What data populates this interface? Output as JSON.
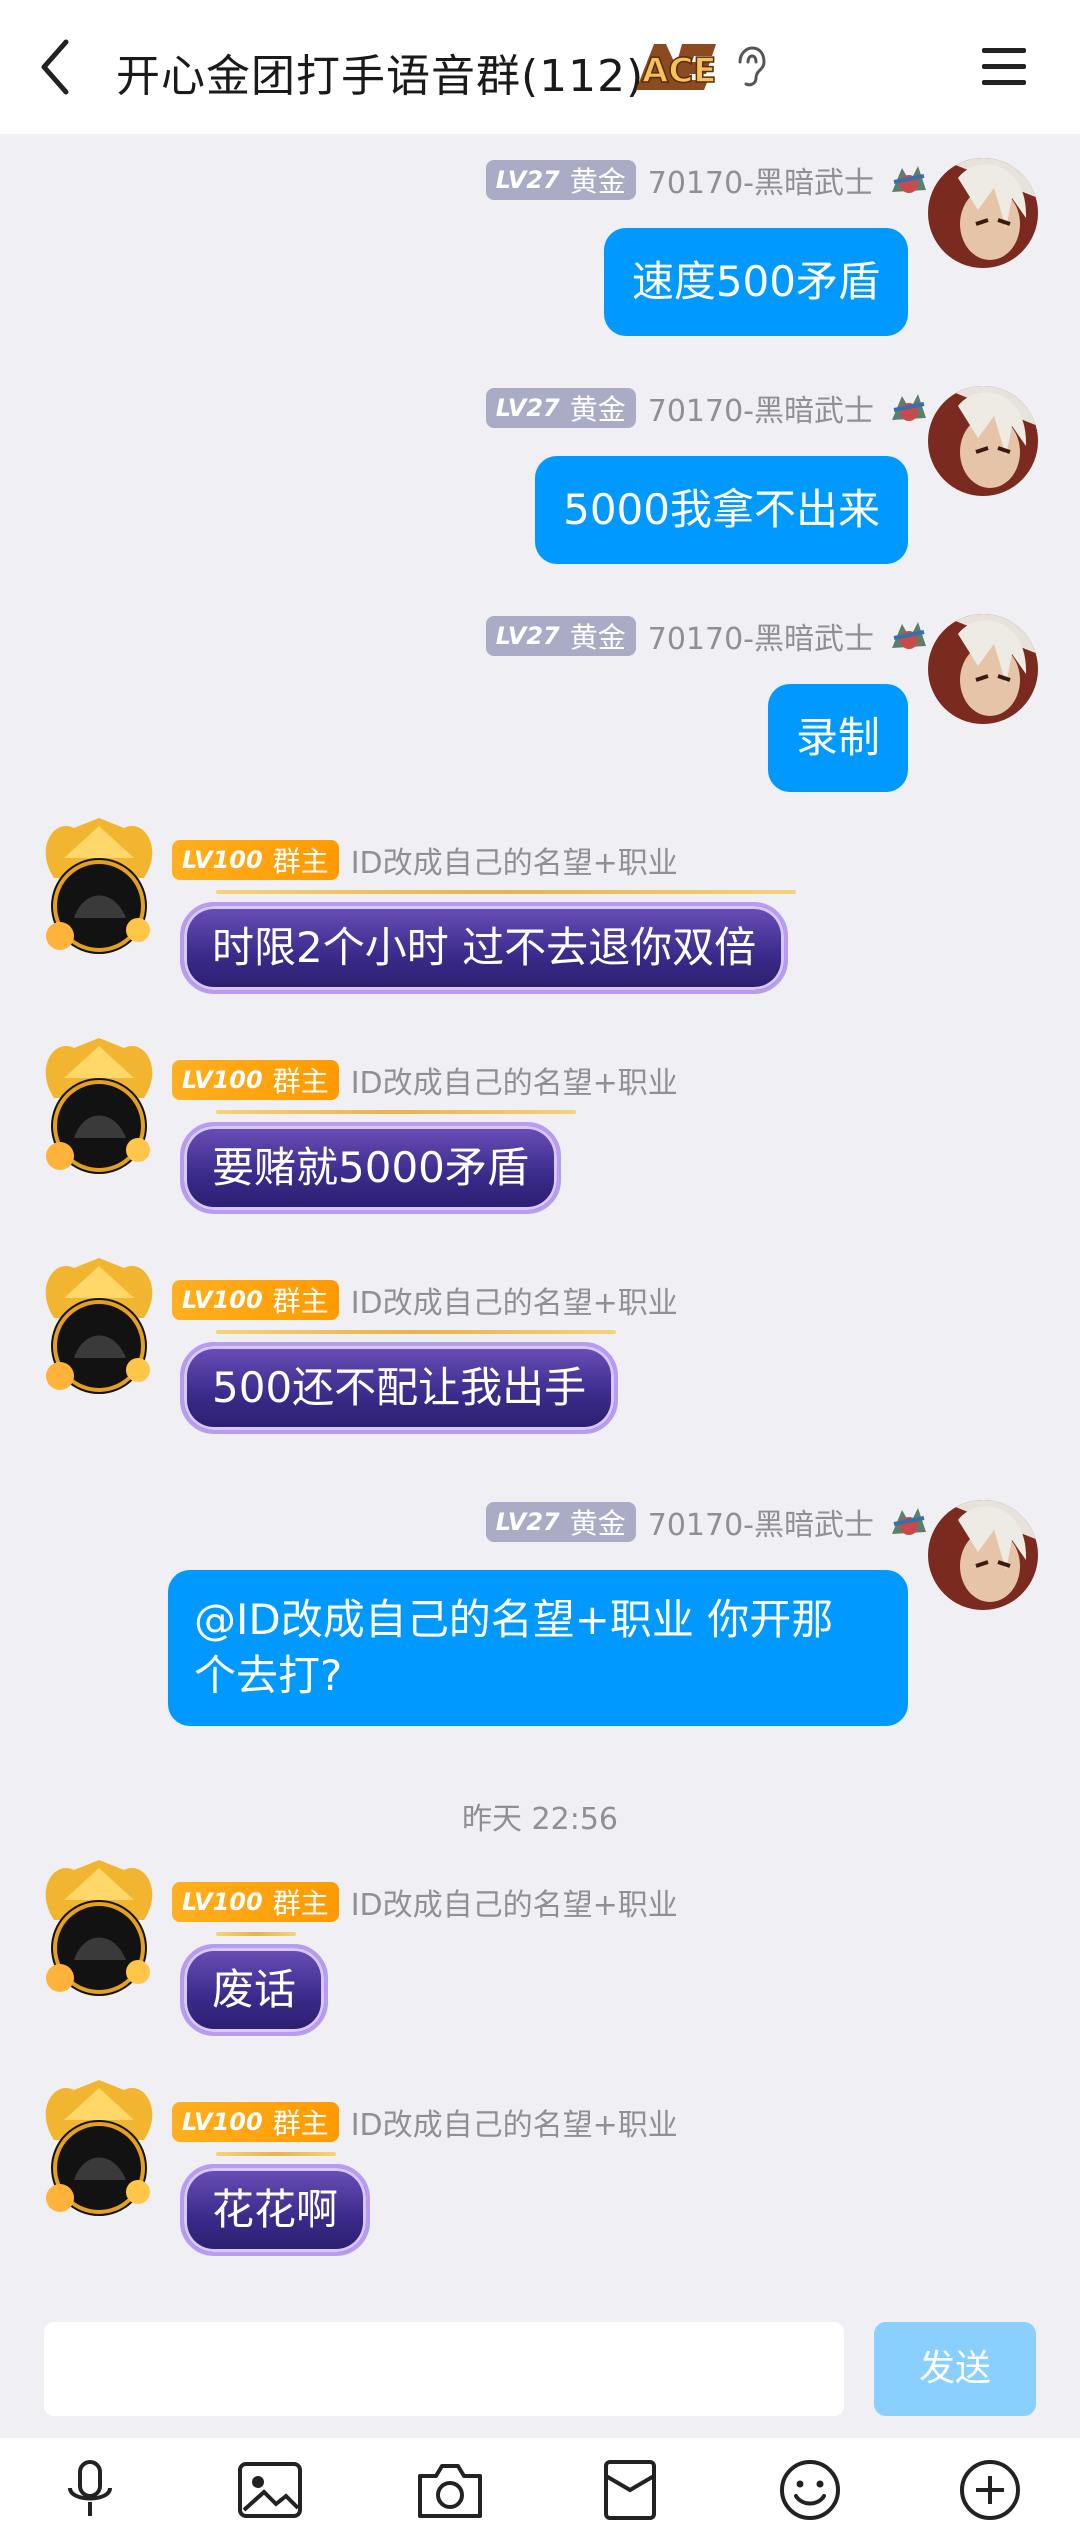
{
  "header": {
    "title": "开心金团打手语音群(112)",
    "badge": "ACE",
    "icons": [
      "back-icon",
      "ace-badge",
      "ear-icon",
      "menu-icon"
    ]
  },
  "colors": {
    "accent": "#0099ff",
    "send_disabled": "#8ad0ff",
    "owner_badge": "#ff9a00",
    "member_badge": "#a9acc4",
    "owner_bubble": "#3a2a8a"
  },
  "messages": [
    {
      "side": "right",
      "level": "LV27",
      "rank": "黄金",
      "nick": "70170-黑暗武士",
      "text": "速度500矛盾"
    },
    {
      "side": "right",
      "level": "LV27",
      "rank": "黄金",
      "nick": "70170-黑暗武士",
      "text": "5000我拿不出来"
    },
    {
      "side": "right",
      "level": "LV27",
      "rank": "黄金",
      "nick": "70170-黑暗武士",
      "text": "录制"
    },
    {
      "side": "left",
      "level": "LV100",
      "rank": "群主",
      "nick": "ID改成自己的名望+职业",
      "text": "时限2个小时 过不去退你双倍"
    },
    {
      "side": "left",
      "level": "LV100",
      "rank": "群主",
      "nick": "ID改成自己的名望+职业",
      "text": "要赌就5000矛盾"
    },
    {
      "side": "left",
      "level": "LV100",
      "rank": "群主",
      "nick": "ID改成自己的名望+职业",
      "text": "500还不配让我出手"
    },
    {
      "side": "right",
      "level": "LV27",
      "rank": "黄金",
      "nick": "70170-黑暗武士",
      "text_line1": "@ID改成自己的名望+职业 你开那",
      "text_line2": "个去打?"
    },
    {
      "side": "left",
      "level": "LV100",
      "rank": "群主",
      "nick": "ID改成自己的名望+职业",
      "text": "废话"
    },
    {
      "side": "left",
      "level": "LV100",
      "rank": "群主",
      "nick": "ID改成自己的名望+职业",
      "text": "花花啊"
    }
  ],
  "timestamp": "昨天 22:56",
  "composer": {
    "value": "",
    "send_label": "发送"
  },
  "toolbar": [
    "microphone-icon",
    "image-icon",
    "camera-icon",
    "red-packet-icon",
    "emoji-icon",
    "plus-icon"
  ]
}
